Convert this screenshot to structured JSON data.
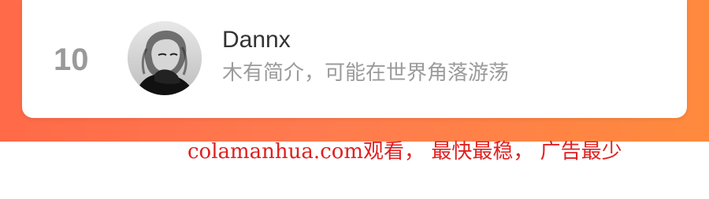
{
  "entry": {
    "rank": "10",
    "name": "Dannx",
    "bio": "木有简介，可能在世界角落游荡",
    "avatar_icon": "user-avatar-portrait"
  },
  "watermark": {
    "text": "colamanhua.com观看， 最快最稳， 广告最少"
  },
  "colors": {
    "banner_start": "#ff6a48",
    "banner_end": "#ff8a3d",
    "rank": "#9a9a9a",
    "name": "#333333",
    "bio": "#9b9b9b",
    "watermark": "#e02020"
  }
}
